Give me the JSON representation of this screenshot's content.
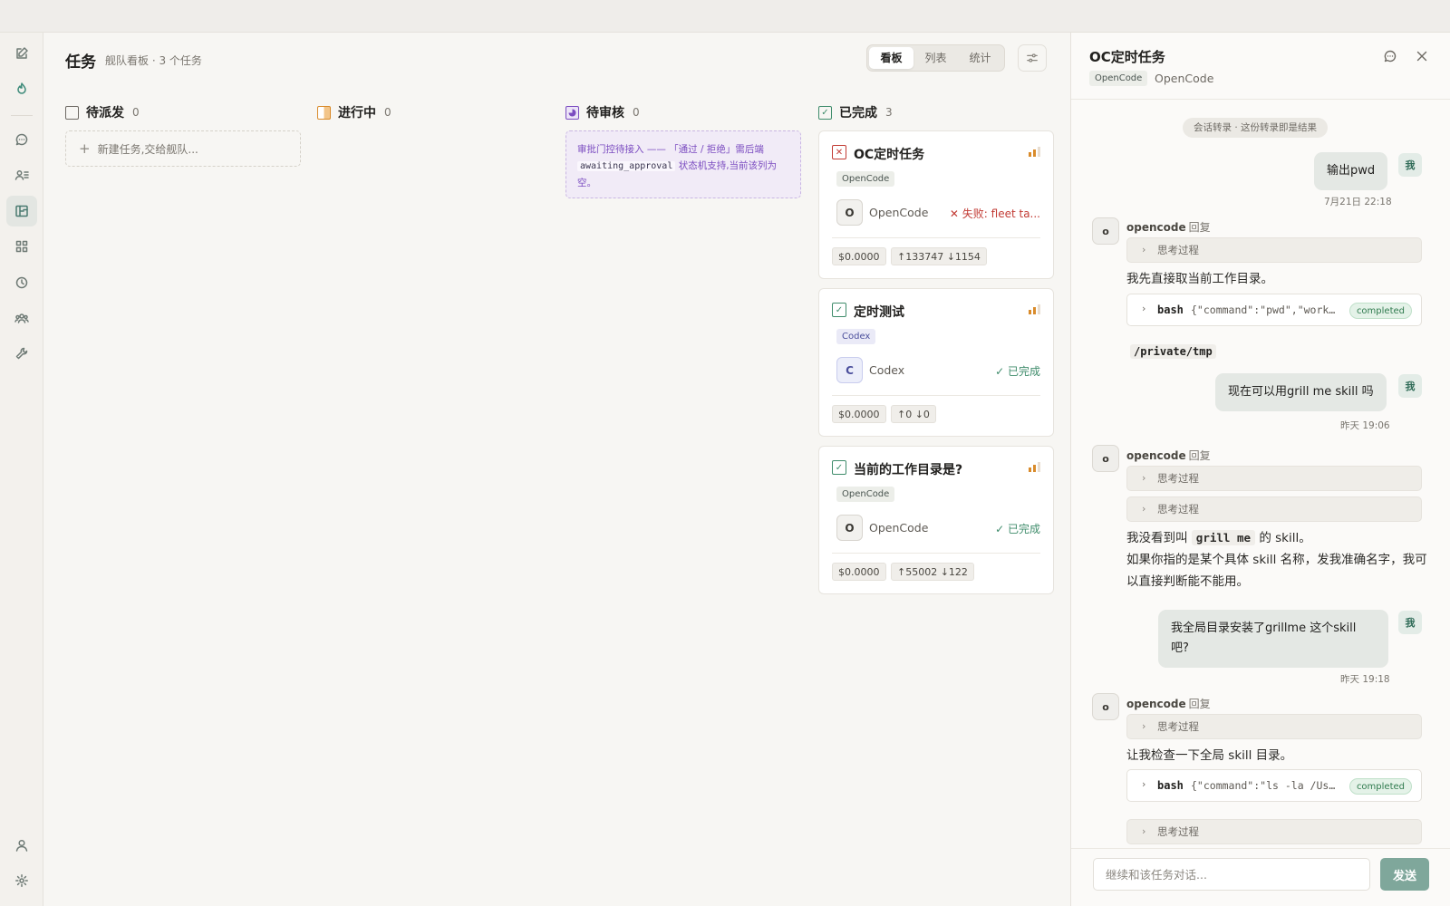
{
  "main": {
    "title": "任务",
    "subtitle": "舰队看板 · 3 个任务",
    "views": [
      "看板",
      "列表",
      "统计"
    ],
    "active_view": "看板"
  },
  "columns": {
    "todo": {
      "title": "待派发",
      "count": "0",
      "new_task": "新建任务,交给舰队...",
      "color": "#6e6a64"
    },
    "doing": {
      "title": "进行中",
      "count": "0",
      "color": "#d98b2b"
    },
    "review": {
      "title": "待审核",
      "count": "0",
      "color": "#7b4cc0",
      "notice_a": "审批门控待接入 —— 「通过 / 拒绝」需后端",
      "notice_code": "awaiting_approval",
      "notice_b": "状态机支持,当前该列为空。"
    },
    "done": {
      "title": "已完成",
      "count": "3",
      "color": "#3f8c6b"
    }
  },
  "cards": [
    {
      "title": "OC定时任务",
      "status_icon": "failed-icon",
      "tag": "OpenCode",
      "agent_initial": "O",
      "agent": "OpenCode",
      "status_text": "失败: fleet ta...",
      "status_mark": "✕",
      "cost": "$0.0000",
      "tokens": "↑133747 ↓1154"
    },
    {
      "title": "定时测试",
      "status_icon": "done-icon",
      "tag": "Codex",
      "agent_initial": "C",
      "agent": "Codex",
      "status_text": "已完成",
      "status_mark": "✓",
      "cost": "$0.0000",
      "tokens": "↑0 ↓0"
    },
    {
      "title": "当前的工作目录是?",
      "status_icon": "done-icon",
      "tag": "OpenCode",
      "agent_initial": "O",
      "agent": "OpenCode",
      "status_text": "已完成",
      "status_mark": "✓",
      "cost": "$0.0000",
      "tokens": "↑55002 ↓122"
    }
  ],
  "panel": {
    "title": "OC定时任务",
    "tag": "OpenCode",
    "agent": "OpenCode",
    "transcript_note": "会话转录 · 这份转录即是结果",
    "user_label": "我",
    "bot_initial": "o",
    "bot_name": "opencode",
    "reply_word": "回复",
    "think_label": "思考过程",
    "messages": {
      "u1": {
        "text": "输出pwd",
        "time": "7月21日 22:18"
      },
      "b1_text": "我先直接取当前工作目录。",
      "tool1": {
        "name": "bash",
        "args": "{\"command\":\"pwd\",\"workdir\":\"/private/tmp\"}",
        "status": "completed"
      },
      "out1": "/private/tmp",
      "u2": {
        "text": "现在可以用grill me skill 吗",
        "time": "昨天 19:06"
      },
      "b2_a": "我没看到叫",
      "b2_code": "grill me",
      "b2_b": "的 skill。",
      "b2_c": "如果你指的是某个具体 skill 名称，发我准确名字，我可以直接判断能不能用。",
      "u3": {
        "text": "我全局目录安装了grillme 这个skill 吧?",
        "time": "昨天 19:18"
      },
      "b3_text": "让我检查一下全局 skill 目录。",
      "tool2": {
        "name": "bash",
        "args": "{\"command\":\"ls -la /Users/skills\"}",
        "status": "completed"
      }
    },
    "composer_placeholder": "继续和该任务对话...",
    "send_label": "发送"
  },
  "colors": {
    "accent": "#3f8c7b",
    "send": "#7fa79b",
    "fail": "#c23b34",
    "done": "#3f8c6b",
    "priority": "#d98b2b"
  }
}
